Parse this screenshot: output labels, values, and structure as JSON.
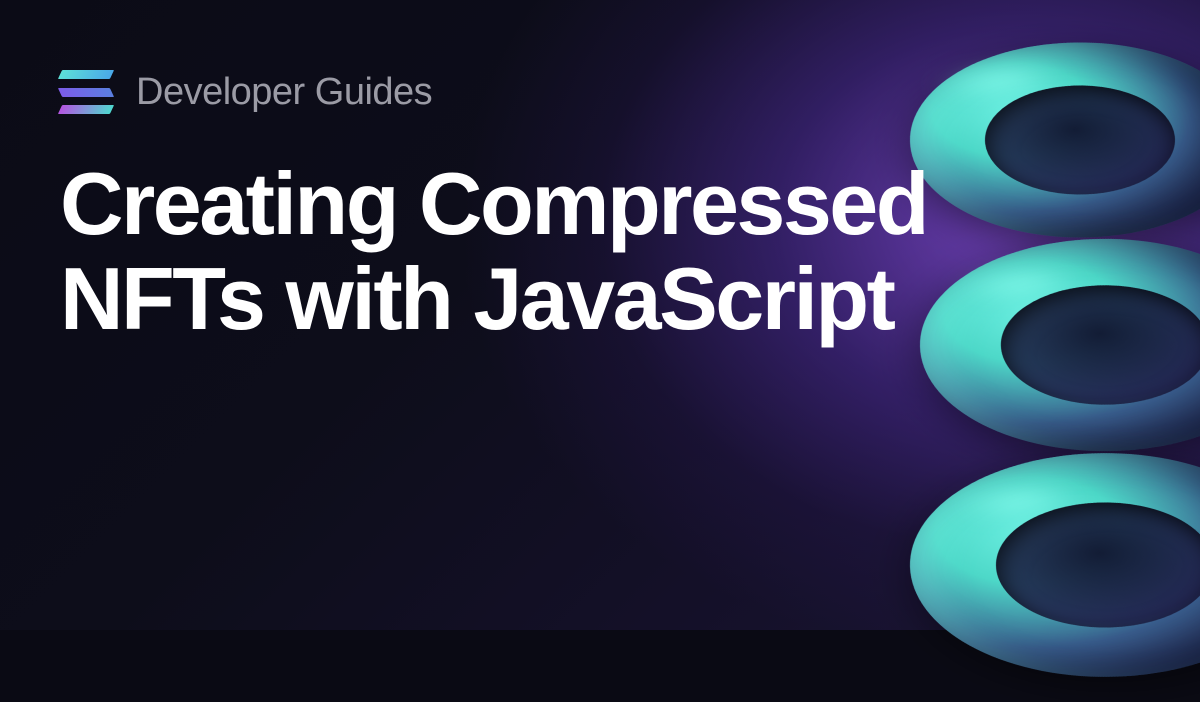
{
  "header": {
    "category": "Developer Guides"
  },
  "title": "Creating Compressed NFTs with JavaScript"
}
